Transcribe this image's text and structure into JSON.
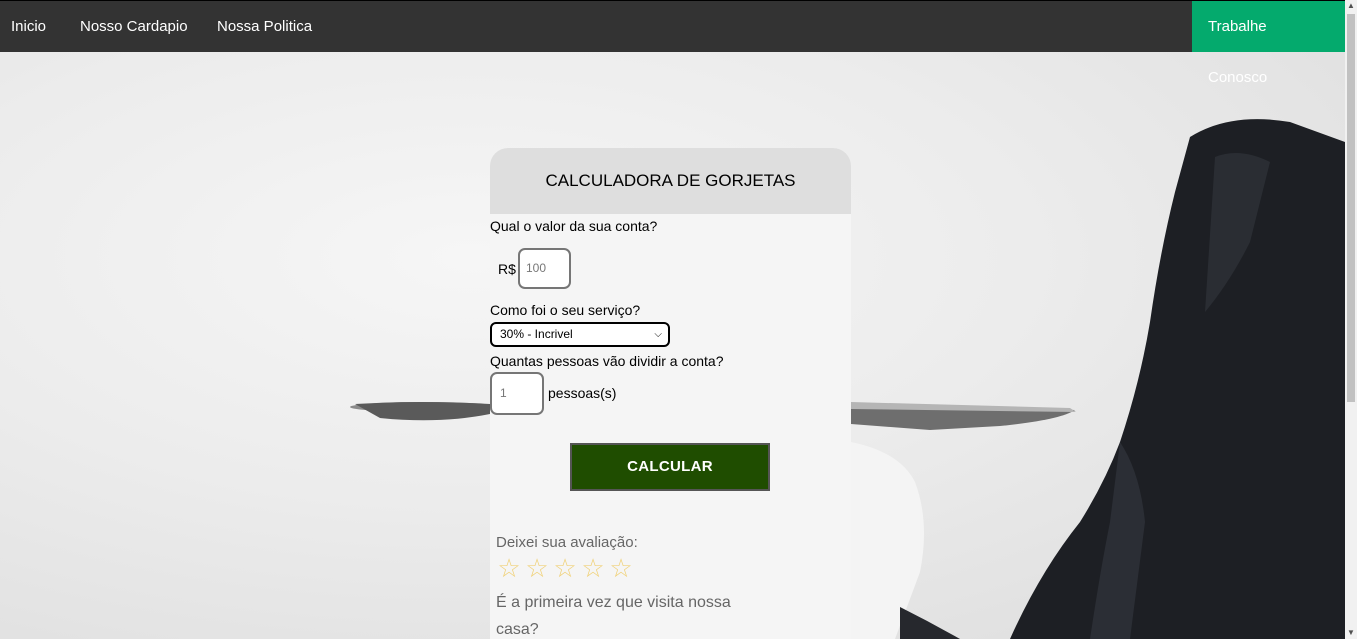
{
  "nav": {
    "links": [
      "Inicio",
      "Nosso Cardapio",
      "Nossa Politica"
    ],
    "cta_label": "Trabalhe Conosco",
    "accent_color": "#04aa6d",
    "background_color": "#333333"
  },
  "calculator": {
    "title": "CALCULADORA DE GORJETAS",
    "bill_question": "Qual o valor da sua conta?",
    "currency_symbol": "R$",
    "bill_placeholder": "100",
    "service_question": "Como foi o seu serviço?",
    "service_selected": "30% - Incrivel",
    "people_question": "Quantas pessoas vão dividir a conta?",
    "people_placeholder": "1",
    "people_suffix": "pessoas(s)",
    "calculate_label": "CALCULAR",
    "button_color": "#1f4d00"
  },
  "rating": {
    "label": "Deixei sua avaliação:",
    "stars": [
      "☆",
      "☆",
      "☆",
      "☆",
      "☆"
    ],
    "first_visit_question": "É a primeira vez que visita nossa casa?"
  }
}
